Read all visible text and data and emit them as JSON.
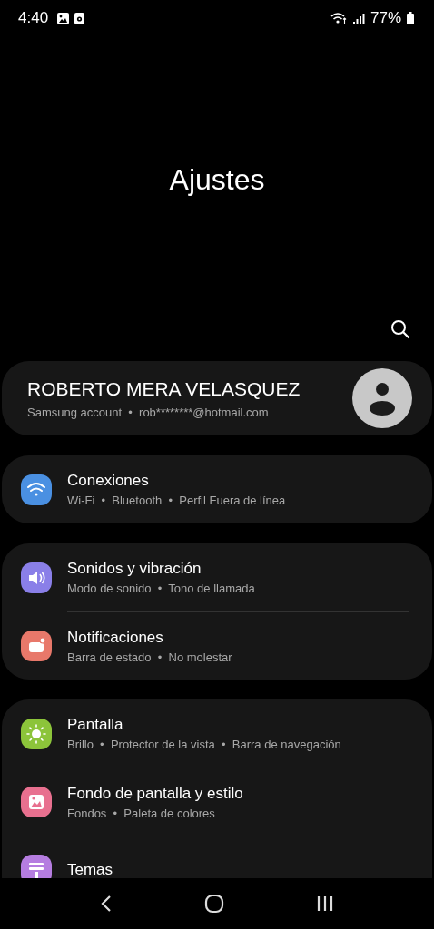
{
  "status_bar": {
    "time": "4:40",
    "battery": "77%"
  },
  "title": "Ajustes",
  "account": {
    "name": "ROBERTO MERA VELASQUEZ",
    "subtitle": "Samsung account  •  rob********@hotmail.com"
  },
  "groups": [
    {
      "items": [
        {
          "kind": "wifi",
          "color": "#4a90e2",
          "title": "Conexiones",
          "subtitle": "Wi-Fi  •  Bluetooth  •  Perfil Fuera de línea"
        }
      ]
    },
    {
      "items": [
        {
          "kind": "sound",
          "color": "#8a7fe8",
          "title": "Sonidos y vibración",
          "subtitle": "Modo de sonido  •  Tono de llamada"
        },
        {
          "kind": "notification",
          "color": "#e8786a",
          "title": "Notificaciones",
          "subtitle": "Barra de estado  •  No molestar"
        }
      ]
    },
    {
      "items": [
        {
          "kind": "display",
          "color": "#8cc43a",
          "title": "Pantalla",
          "subtitle": "Brillo  •  Protector de la vista  •  Barra de navegación"
        },
        {
          "kind": "wallpaper",
          "color": "#e8708f",
          "title": "Fondo de pantalla y estilo",
          "subtitle": "Fondos  •  Paleta de colores"
        },
        {
          "kind": "themes",
          "color": "#b57de0",
          "title": "Temas"
        }
      ]
    }
  ]
}
